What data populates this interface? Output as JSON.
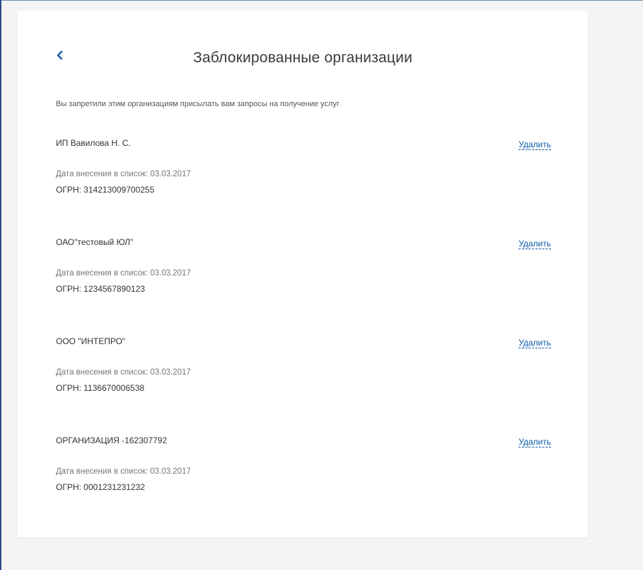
{
  "page": {
    "title": "Заблокированные организации",
    "subtitle": "Вы запретили этим организациям присылать вам запросы на получение услуг",
    "back_icon": "chevron-left-icon"
  },
  "organizations": [
    {
      "name": "ИП Вавилова Н. С.",
      "date": "Дата внесения в список: 03.03.2017",
      "ogrn": "ОГРН: 314213009700255",
      "delete_label": "Удалить"
    },
    {
      "name": "ОАО\"тестовый ЮЛ\"",
      "date": "Дата внесения в список: 03.03.2017",
      "ogrn": "ОГРН: 1234567890123",
      "delete_label": "Удалить"
    },
    {
      "name": "ООО \"ИНТЕПРО\"",
      "date": "Дата внесения в список: 03.03.2017",
      "ogrn": "ОГРН: 1136670006538",
      "delete_label": "Удалить"
    },
    {
      "name": "ОРГАНИЗАЦИЯ -162307792",
      "date": "Дата внесения в список: 03.03.2017",
      "ogrn": "ОГРН: 0001231231232",
      "delete_label": "Удалить"
    }
  ],
  "colors": {
    "link": "#0a5aa8",
    "back_icon": "#0a5aa8",
    "text": "#333333",
    "muted": "#777777"
  }
}
